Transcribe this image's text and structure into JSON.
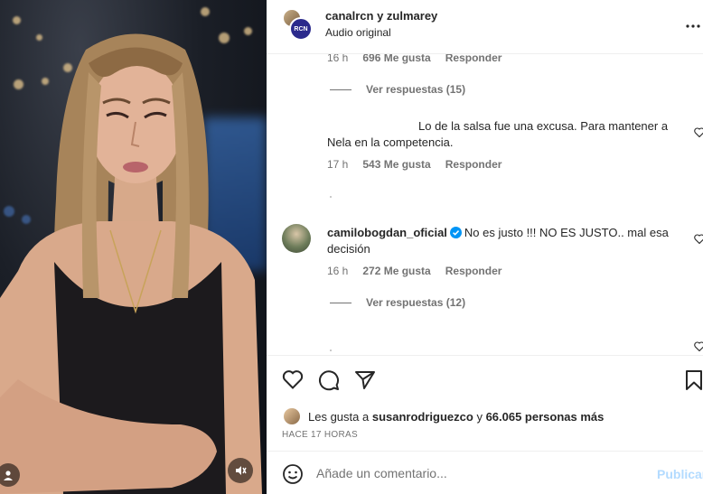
{
  "header": {
    "title": "canalrcn y zulmarey",
    "subtitle": "Audio original",
    "badge_text": "RCN",
    "more_icon": "more-horizontal-icon"
  },
  "comments": {
    "first_meta": {
      "time": "16 h",
      "likes": "696 Me gusta",
      "reply": "Responder"
    },
    "first_view_replies": "Ver respuestas (15)",
    "second": {
      "text_line1": "Lo de la salsa fue una excusa. Para mantener a",
      "text_line2": "Nela en la competencia.",
      "time": "17 h",
      "likes": "543 Me gusta",
      "reply": "Responder"
    },
    "third": {
      "username": "camilobogdan_oficial",
      "text_line1": "No es justo !!! NO ES JUSTO.. mal esa",
      "text_line2": "decisión",
      "time": "16 h",
      "likes": "272 Me gusta",
      "reply": "Responder",
      "view_replies": "Ver respuestas (12)"
    }
  },
  "actions": {
    "like_icon": "heart-icon",
    "comment_icon": "comment-icon",
    "share_icon": "send-icon",
    "save_icon": "bookmark-icon",
    "liked_by_prefix": "Les gusta a",
    "liked_by_user": "susanrodriguezco",
    "liked_by_suffix_connector": "y",
    "liked_by_others": "66.065 personas más",
    "timestamp": "HACE 17 HORAS"
  },
  "add_comment": {
    "placeholder": "Añade un comentario...",
    "post_label": "Publicar",
    "emoji_icon": "emoji-icon"
  },
  "colors": {
    "text": "#262626",
    "secondary": "#737373",
    "divider": "#efefef",
    "verified": "#0095f6",
    "post_disabled": "#b3dbff"
  }
}
